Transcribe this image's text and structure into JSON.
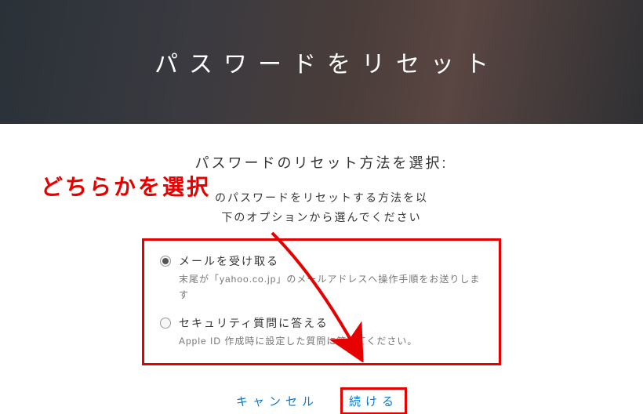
{
  "hero": {
    "title": "パスワードをリセット"
  },
  "subtitle": "パスワードのリセット方法を選択:",
  "lead_line1_masked_prefix": "",
  "lead_line1_rest": "のパスワードをリセットする方法を以",
  "lead_line2": "下のオプションから選んでください",
  "options": [
    {
      "label": "メールを受け取る",
      "desc": "末尾が「yahoo.co.jp」のメールアドレスへ操作手順をお送りします",
      "checked": true
    },
    {
      "label": "セキュリティ質問に答える",
      "desc": "Apple ID 作成時に設定した質問に答えてください。",
      "checked": false
    }
  ],
  "buttons": {
    "cancel": "キャンセル",
    "continue": "続ける"
  },
  "annotation": {
    "text": "どちらかを選択"
  }
}
